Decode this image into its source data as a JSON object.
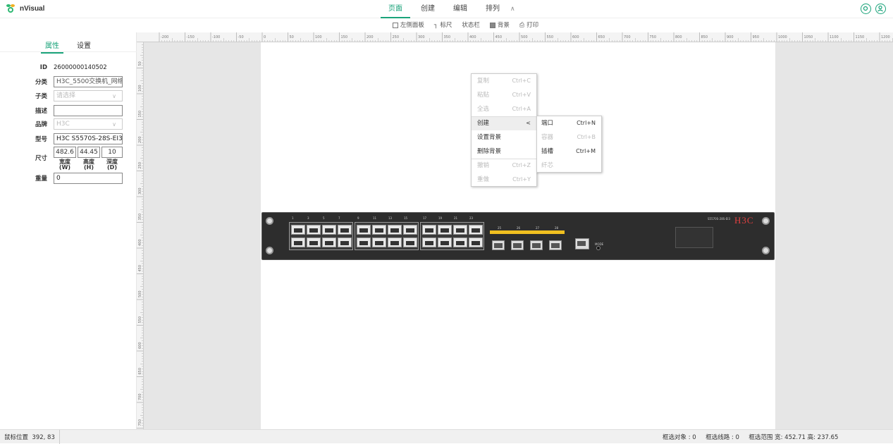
{
  "app": {
    "name": "nVisual"
  },
  "menu": {
    "items": [
      "页面",
      "创建",
      "编辑",
      "排列"
    ],
    "active": "页面",
    "collapse_icon": "double-chevron-up-icon"
  },
  "toolbar": {
    "items": [
      "左侧面板",
      "标尺",
      "状态栏",
      "背景",
      "打印"
    ]
  },
  "panel": {
    "tabs": [
      "属性",
      "设置"
    ],
    "active_tab": "属性",
    "fields": {
      "id_label": "ID",
      "id_value": "26000000140502",
      "category_label": "分类",
      "category_value": "H3C_5500交换机_网络",
      "subtype_label": "子类",
      "subtype_placeholder": "请选择",
      "desc_label": "描述",
      "desc_value": "",
      "brand_label": "品牌",
      "brand_value": "H3C",
      "model_label": "型号",
      "model_value": "H3C S5570S-28S-EI3",
      "size_label": "尺寸",
      "width_value": "482.6",
      "height_value": "44.45",
      "depth_value": "10",
      "width_label": "宽度",
      "width_unit": "(W)",
      "height_label": "高度",
      "height_unit": "(H)",
      "depth_label": "深度",
      "depth_unit": "(D)",
      "weight_label": "重量",
      "weight_value": "0"
    }
  },
  "ruler": {
    "h_ticks": [
      "-200",
      "-150",
      "-100",
      "-50",
      "0",
      "50",
      "100",
      "150",
      "200",
      "250",
      "300",
      "350",
      "400",
      "450",
      "500",
      "550",
      "600",
      "650",
      "700",
      "750",
      "800",
      "850",
      "900",
      "950",
      "1000",
      "1050",
      "1100",
      "1150",
      "1200"
    ],
    "v_ticks": [
      "50",
      "100",
      "150",
      "200",
      "250",
      "300",
      "350",
      "400",
      "450",
      "500",
      "550",
      "600",
      "650",
      "700",
      "750"
    ]
  },
  "device": {
    "brand": "H3C",
    "port_labels": [
      "1",
      "3",
      "5",
      "7",
      "9",
      "11",
      "13",
      "15",
      "17",
      "19",
      "21",
      "23"
    ],
    "sfp_labels": [
      "25",
      "26",
      "27",
      "28"
    ],
    "mode_label": "MODE"
  },
  "context_menu": {
    "items": [
      {
        "label": "复制",
        "shortcut": "Ctrl+C",
        "disabled": true
      },
      {
        "label": "粘贴",
        "shortcut": "Ctrl+V",
        "disabled": true
      },
      {
        "label": "全选",
        "shortcut": "Ctrl+A",
        "disabled": true
      },
      {
        "label": "创建",
        "shortcut": "<",
        "disabled": false
      },
      {
        "label": "设置背景",
        "shortcut": "",
        "disabled": false
      },
      {
        "label": "删除背景",
        "shortcut": "",
        "disabled": false
      },
      {
        "label": "撤销",
        "shortcut": "Ctrl+Z",
        "disabled": true
      },
      {
        "label": "重做",
        "shortcut": "Ctrl+Y",
        "disabled": true
      }
    ],
    "submenu": [
      {
        "label": "端口",
        "shortcut": "Ctrl+N",
        "disabled": false
      },
      {
        "label": "容器",
        "shortcut": "Ctrl+B",
        "disabled": true
      },
      {
        "label": "插槽",
        "shortcut": "Ctrl+M",
        "disabled": false
      },
      {
        "label": "纤芯",
        "shortcut": "",
        "disabled": true
      }
    ]
  },
  "status": {
    "mouse_label": "鼠标位置",
    "mouse_value": "392, 83",
    "selected_objects": "框选对象 : 0",
    "selected_lines": "框选线路 : 0",
    "selected_range": "框选范围 宽: 452.71 高: 237.65"
  }
}
